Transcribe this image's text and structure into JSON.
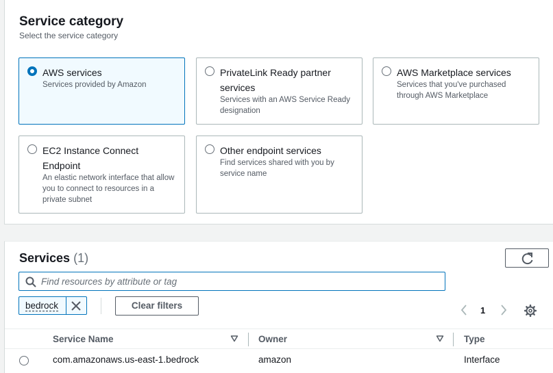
{
  "category": {
    "title": "Service category",
    "description": "Select the service category",
    "options": [
      {
        "label": "AWS services",
        "description": "Services provided by Amazon",
        "selected": true
      },
      {
        "label": "PrivateLink Ready partner services",
        "description": "Services with an AWS Service Ready designation",
        "selected": false
      },
      {
        "label": "AWS Marketplace services",
        "description": "Services that you've purchased through AWS Marketplace",
        "selected": false
      },
      {
        "label": "EC2 Instance Connect Endpoint",
        "description": "An elastic network interface that allow you to connect to resources in a private subnet",
        "selected": false
      },
      {
        "label": "Other endpoint services",
        "description": "Find services shared with you by service name",
        "selected": false
      }
    ]
  },
  "services": {
    "title": "Services",
    "count": "(1)",
    "search_placeholder": "Find resources by attribute or tag",
    "filter_token": "bedrock",
    "clear_filters_label": "Clear filters",
    "page_number": "1",
    "columns": [
      "Service Name",
      "Owner",
      "Type"
    ],
    "rows": [
      {
        "service_name": "com.amazonaws.us-east-1.bedrock",
        "owner": "amazon",
        "type": "Interface"
      }
    ]
  },
  "colors": {
    "accent": "#0073bb",
    "selected_bg": "#f1faff",
    "border": "#aab7b8"
  },
  "icons": [
    "radio-selected-icon",
    "radio-icon",
    "refresh-icon",
    "search-icon",
    "close-icon",
    "chevron-left-icon",
    "chevron-right-icon",
    "gear-icon",
    "sort-caret-icon"
  ]
}
